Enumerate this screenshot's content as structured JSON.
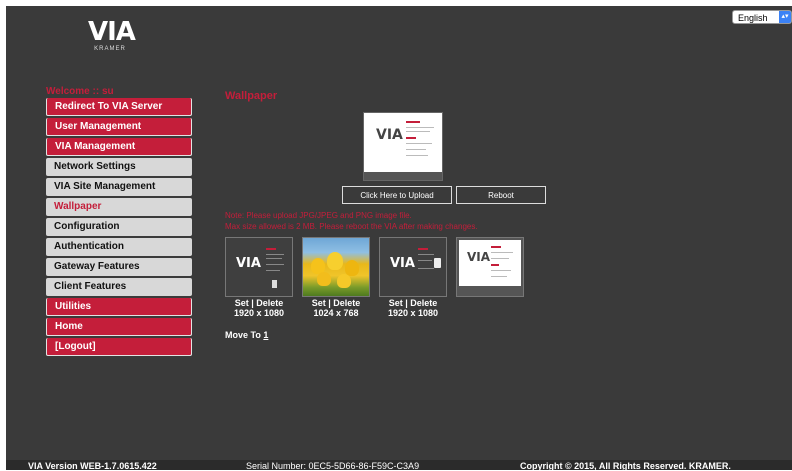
{
  "language": {
    "selected": "English"
  },
  "logo": {
    "text": "VIA",
    "subtext": "KRAMER"
  },
  "welcome": "Welcome :: su",
  "nav": {
    "items": [
      {
        "label": "Redirect To VIA Server",
        "style": "red"
      },
      {
        "label": "User Management",
        "style": "red"
      },
      {
        "label": "VIA Management",
        "style": "red"
      },
      {
        "label": "Network Settings",
        "style": "grey"
      },
      {
        "label": "VIA Site Management",
        "style": "grey"
      },
      {
        "label": "Wallpaper",
        "style": "active"
      },
      {
        "label": "Configuration",
        "style": "grey"
      },
      {
        "label": "Authentication",
        "style": "grey"
      },
      {
        "label": "Gateway Features",
        "style": "grey"
      },
      {
        "label": "Client Features",
        "style": "grey"
      },
      {
        "label": "Utilities",
        "style": "red"
      },
      {
        "label": "Home",
        "style": "red"
      },
      {
        "label": "[Logout]",
        "style": "red"
      }
    ]
  },
  "main": {
    "title": "Wallpaper",
    "upload_label": "Click Here to Upload",
    "reboot_label": "Reboot",
    "note_line1": "Note: Please upload JPG/JPEG and PNG image file.",
    "note_line2": "Max size allowed is 2 MB. Please reboot the VIA after making changes.",
    "thumbnails": [
      {
        "kind": "dark-slide",
        "set_label": "Set",
        "delete_label": "Delete",
        "size": "1920 x 1080"
      },
      {
        "kind": "tulips",
        "set_label": "Set",
        "delete_label": "Delete",
        "size": "1024 x 768"
      },
      {
        "kind": "dark-slide-2",
        "set_label": "Set",
        "delete_label": "Delete",
        "size": "1920 x 1080"
      },
      {
        "kind": "light-slide"
      }
    ],
    "move_to_label": "Move To",
    "move_to_page": "1"
  },
  "footer": {
    "version": "VIA Version WEB-1.7.0615.422",
    "serial": "Serial Number: 0EC5-5D66-86-F59C-C3A9",
    "copyright": "Copyright © 2015, All Rights Reserved. KRAMER."
  },
  "colors": {
    "accent": "#c41e3a",
    "background": "#3a3a3a",
    "nav_grey": "#d8d8d8"
  }
}
